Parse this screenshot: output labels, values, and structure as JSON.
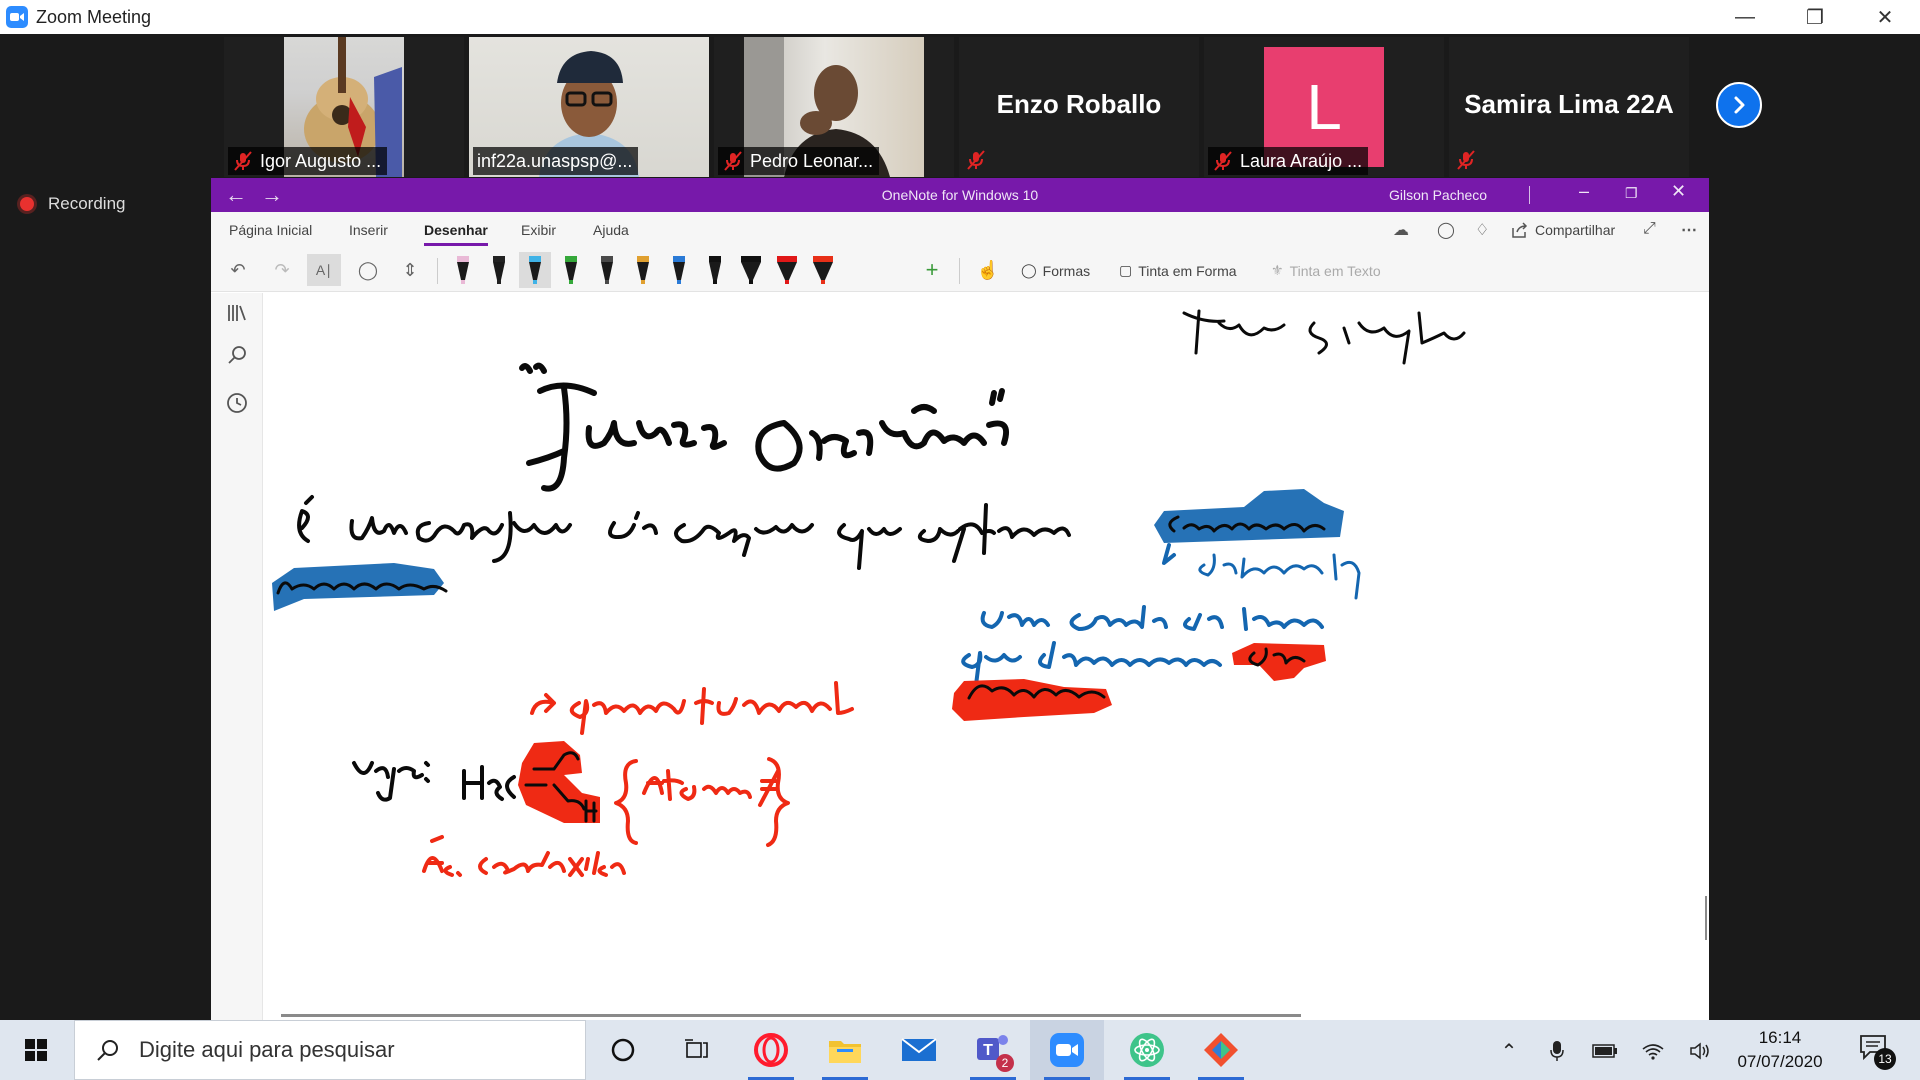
{
  "zoom": {
    "window_title": "Zoom Meeting",
    "recording_label": "Recording",
    "participants": [
      {
        "name": "Igor Augusto ...",
        "type": "video"
      },
      {
        "name": "inf22a.unaspsp@...",
        "type": "video",
        "active_speaker": true
      },
      {
        "name": "Pedro Leonar...",
        "type": "video"
      },
      {
        "name": "Enzo Roballo",
        "type": "name-only"
      },
      {
        "name": "Laura Araújo ...",
        "type": "avatar",
        "avatar_letter": "L",
        "avatar_color": "#e83e6f"
      },
      {
        "name": "Samira Lima 22A",
        "type": "name-only"
      }
    ]
  },
  "onenote": {
    "app_title": "OneNote for Windows 10",
    "user_name": "Gilson Pacheco",
    "tabs": [
      "Página Inicial",
      "Inserir",
      "Desenhar",
      "Exibir",
      "Ajuda"
    ],
    "active_tab": "Desenhar",
    "share_label": "Compartilhar",
    "toolbar": {
      "shapes_label": "Formas",
      "ink_to_shape_label": "Tinta em Forma",
      "ink_to_text_label": "Tinta em Texto"
    },
    "pen_colors": [
      "#e9b9d6",
      "#222222",
      "#3fb2e6",
      "#35a83a",
      "#4a4a4a",
      "#e0a030",
      "#2a7ad6",
      "#111111",
      "#111111",
      "#e01818",
      "#e83018"
    ],
    "ink_colors": {
      "black": "#0a0a0a",
      "blue": "#1466b0",
      "red": "#ef2a14"
    }
  },
  "taskbar": {
    "search_placeholder": "Digite aqui para pesquisar",
    "time": "16:14",
    "date": "07/07/2020",
    "notification_count": "13",
    "teams_badge": "2"
  }
}
